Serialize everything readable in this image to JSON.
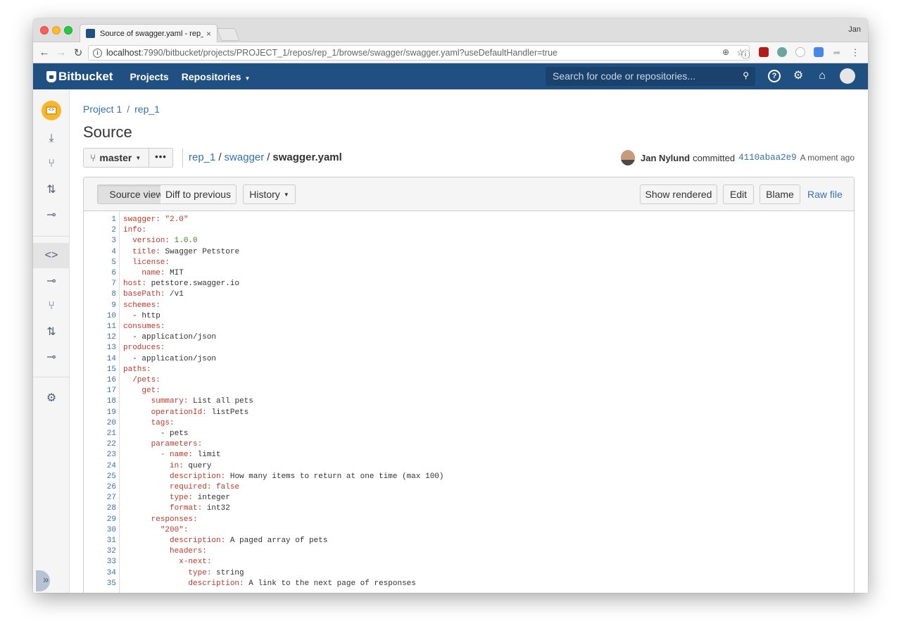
{
  "browser": {
    "tab_title": "Source of swagger.yaml - rep_1",
    "tab_close": "×",
    "user_name": "Jan",
    "url_host": "localhost",
    "url_rest": ":7990/bitbucket/projects/PROJECT_1/repos/rep_1/browse/swagger/swagger.yaml?useDefaultHandler=true"
  },
  "header": {
    "logo": "Bitbucket",
    "nav_projects": "Projects",
    "nav_repositories": "Repositories",
    "search_placeholder": "Search for code or repositories..."
  },
  "breadcrumb": {
    "project": "Project 1",
    "repo": "rep_1"
  },
  "page_title": "Source",
  "branch": {
    "name": "master",
    "more": "•••"
  },
  "file_path": {
    "repo": "rep_1",
    "folder": "swagger",
    "file": "swagger.yaml"
  },
  "commit": {
    "author": "Jan Nylund",
    "verb": "committed",
    "hash": "4110abaa2e9",
    "time": "A moment ago"
  },
  "viewer": {
    "source_view": "Source view",
    "diff_previous": "Diff to previous",
    "history": "History",
    "show_rendered": "Show rendered",
    "edit": "Edit",
    "blame": "Blame",
    "raw_file": "Raw file"
  },
  "code_lines": [
    {
      "n": "1",
      "indent": "",
      "key": "swagger",
      "sep": ": ",
      "val": "\"2.0\"",
      "vt": "s"
    },
    {
      "n": "2",
      "indent": "",
      "key": "info",
      "sep": ":",
      "val": "",
      "vt": ""
    },
    {
      "n": "3",
      "indent": "  ",
      "key": "version",
      "sep": ": ",
      "val": "1.0.0",
      "vt": "n"
    },
    {
      "n": "4",
      "indent": "  ",
      "key": "title",
      "sep": ": ",
      "val": "Swagger Petstore",
      "vt": ""
    },
    {
      "n": "5",
      "indent": "  ",
      "key": "license",
      "sep": ":",
      "val": "",
      "vt": ""
    },
    {
      "n": "6",
      "indent": "    ",
      "key": "name",
      "sep": ": ",
      "val": "MIT",
      "vt": ""
    },
    {
      "n": "7",
      "indent": "",
      "key": "host",
      "sep": ": ",
      "val": "petstore.swagger.io",
      "vt": ""
    },
    {
      "n": "8",
      "indent": "",
      "key": "basePath",
      "sep": ": ",
      "val": "/v1",
      "vt": ""
    },
    {
      "n": "9",
      "indent": "",
      "key": "schemes",
      "sep": ":",
      "val": "",
      "vt": ""
    },
    {
      "n": "10",
      "indent": "  ",
      "key": "",
      "sep": "- ",
      "val": "http",
      "vt": ""
    },
    {
      "n": "11",
      "indent": "",
      "key": "consumes",
      "sep": ":",
      "val": "",
      "vt": ""
    },
    {
      "n": "12",
      "indent": "  ",
      "key": "",
      "sep": "- ",
      "val": "application/json",
      "vt": ""
    },
    {
      "n": "13",
      "indent": "",
      "key": "produces",
      "sep": ":",
      "val": "",
      "vt": ""
    },
    {
      "n": "14",
      "indent": "  ",
      "key": "",
      "sep": "- ",
      "val": "application/json",
      "vt": ""
    },
    {
      "n": "15",
      "indent": "",
      "key": "paths",
      "sep": ":",
      "val": "",
      "vt": ""
    },
    {
      "n": "16",
      "indent": "  ",
      "key": "/pets",
      "sep": ":",
      "val": "",
      "vt": ""
    },
    {
      "n": "17",
      "indent": "    ",
      "key": "get",
      "sep": ":",
      "val": "",
      "vt": ""
    },
    {
      "n": "18",
      "indent": "      ",
      "key": "summary",
      "sep": ": ",
      "val": "List all pets",
      "vt": ""
    },
    {
      "n": "19",
      "indent": "      ",
      "key": "operationId",
      "sep": ": ",
      "val": "listPets",
      "vt": ""
    },
    {
      "n": "20",
      "indent": "      ",
      "key": "tags",
      "sep": ":",
      "val": "",
      "vt": ""
    },
    {
      "n": "21",
      "indent": "        ",
      "key": "",
      "sep": "- ",
      "val": "pets",
      "vt": ""
    },
    {
      "n": "22",
      "indent": "      ",
      "key": "parameters",
      "sep": ":",
      "val": "",
      "vt": ""
    },
    {
      "n": "23",
      "indent": "        ",
      "key": "- name",
      "sep": ": ",
      "val": "limit",
      "vt": ""
    },
    {
      "n": "24",
      "indent": "          ",
      "key": "in",
      "sep": ": ",
      "val": "query",
      "vt": ""
    },
    {
      "n": "25",
      "indent": "          ",
      "key": "description",
      "sep": ": ",
      "val": "How many items to return at one time (max 100)",
      "vt": ""
    },
    {
      "n": "26",
      "indent": "          ",
      "key": "required",
      "sep": ": ",
      "val": "false",
      "vt": "b"
    },
    {
      "n": "27",
      "indent": "          ",
      "key": "type",
      "sep": ": ",
      "val": "integer",
      "vt": ""
    },
    {
      "n": "28",
      "indent": "          ",
      "key": "format",
      "sep": ": ",
      "val": "int32",
      "vt": ""
    },
    {
      "n": "29",
      "indent": "      ",
      "key": "responses",
      "sep": ":",
      "val": "",
      "vt": ""
    },
    {
      "n": "30",
      "indent": "        ",
      "key": "\"200\"",
      "sep": ":",
      "val": "",
      "vt": ""
    },
    {
      "n": "31",
      "indent": "          ",
      "key": "description",
      "sep": ": ",
      "val": "A paged array of pets",
      "vt": ""
    },
    {
      "n": "32",
      "indent": "          ",
      "key": "headers",
      "sep": ":",
      "val": "",
      "vt": ""
    },
    {
      "n": "33",
      "indent": "            ",
      "key": "x-next",
      "sep": ":",
      "val": "",
      "vt": ""
    },
    {
      "n": "34",
      "indent": "              ",
      "key": "type",
      "sep": ": ",
      "val": "string",
      "vt": ""
    },
    {
      "n": "35",
      "indent": "              ",
      "key": "description",
      "sep": ": ",
      "val": "A link to the next page of responses",
      "vt": ""
    }
  ],
  "colors": {
    "header_bg": "#205081",
    "link": "#3572b0",
    "yaml_key": "#c0392b",
    "yaml_number": "#3d8a1b"
  }
}
